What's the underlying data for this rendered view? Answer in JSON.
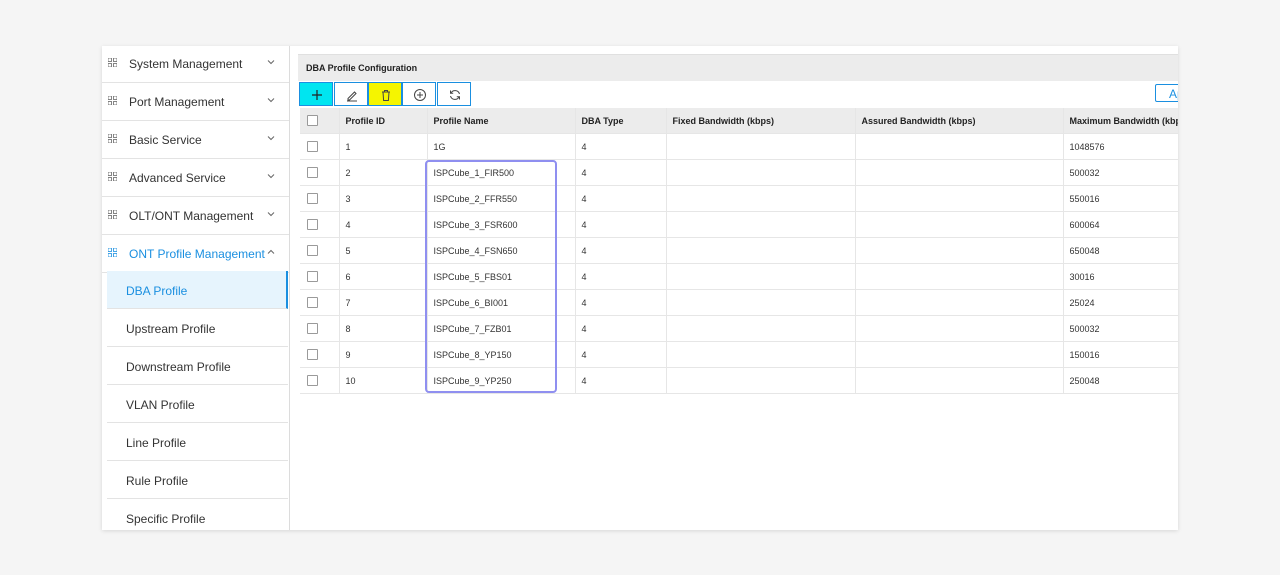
{
  "sidebar": {
    "menu": [
      {
        "label": "System Management",
        "expanded": false
      },
      {
        "label": "Port Management",
        "expanded": false
      },
      {
        "label": "Basic Service",
        "expanded": false
      },
      {
        "label": "Advanced Service",
        "expanded": false
      },
      {
        "label": "OLT/ONT Management",
        "expanded": false
      },
      {
        "label": "ONT Profile Management",
        "expanded": true
      }
    ],
    "submenu": [
      {
        "label": "DBA Profile",
        "selected": true
      },
      {
        "label": "Upstream Profile"
      },
      {
        "label": "Downstream Profile"
      },
      {
        "label": "VLAN Profile"
      },
      {
        "label": "Line Profile"
      },
      {
        "label": "Rule Profile"
      },
      {
        "label": "Specific Profile"
      }
    ],
    "active_color": "#1a8fe0"
  },
  "panel": {
    "title": "DBA Profile Configuration"
  },
  "toolbar": {
    "buttons": [
      {
        "icon": "plus-icon",
        "color": "#00e5f0"
      },
      {
        "icon": "edit-pencil-icon"
      },
      {
        "icon": "trash-icon",
        "color": "#f5f500"
      },
      {
        "icon": "circle-plus-icon"
      },
      {
        "icon": "refresh-icon"
      }
    ],
    "apply_label": "Ap"
  },
  "table": {
    "columns": [
      "Profile ID",
      "Profile Name",
      "DBA Type",
      "Fixed Bandwidth (kbps)",
      "Assured Bandwidth (kbps)",
      "Maximum Bandwidth (kbps)"
    ],
    "rows": [
      {
        "id": "1",
        "name": "1G",
        "type": "4",
        "fixed": "",
        "assured": "",
        "max": "1048576"
      },
      {
        "id": "2",
        "name": "ISPCube_1_FIR500",
        "type": "4",
        "fixed": "",
        "assured": "",
        "max": "500032"
      },
      {
        "id": "3",
        "name": "ISPCube_2_FFR550",
        "type": "4",
        "fixed": "",
        "assured": "",
        "max": "550016"
      },
      {
        "id": "4",
        "name": "ISPCube_3_FSR600",
        "type": "4",
        "fixed": "",
        "assured": "",
        "max": "600064"
      },
      {
        "id": "5",
        "name": "ISPCube_4_FSN650",
        "type": "4",
        "fixed": "",
        "assured": "",
        "max": "650048"
      },
      {
        "id": "6",
        "name": "ISPCube_5_FBS01",
        "type": "4",
        "fixed": "",
        "assured": "",
        "max": "30016"
      },
      {
        "id": "7",
        "name": "ISPCube_6_BI001",
        "type": "4",
        "fixed": "",
        "assured": "",
        "max": "25024"
      },
      {
        "id": "8",
        "name": "ISPCube_7_FZB01",
        "type": "4",
        "fixed": "",
        "assured": "",
        "max": "500032"
      },
      {
        "id": "9",
        "name": "ISPCube_8_YP150",
        "type": "4",
        "fixed": "",
        "assured": "",
        "max": "150016"
      },
      {
        "id": "10",
        "name": "ISPCube_9_YP250",
        "type": "4",
        "fixed": "",
        "assured": "",
        "max": "250048"
      }
    ],
    "highlight_color": "#8f8ff0"
  }
}
